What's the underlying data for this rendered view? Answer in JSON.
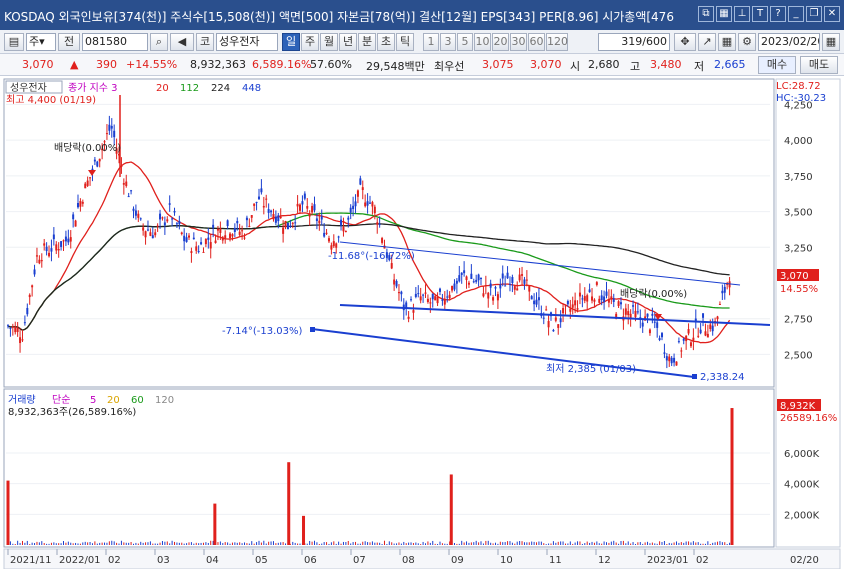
{
  "window": {
    "title": "KOSDAQ 외국인보유[374(천)] 주식수[15,508(천)] 액면[500] 자본금[78(억)] 결산[12월] EPS[343] PER[8.96] 시가총액[476"
  },
  "toolbar": {
    "type_select": "주",
    "prev_label": "전",
    "code": "081580",
    "kospi_label": "코",
    "stock_name": "성우전자",
    "periods": [
      "일",
      "주",
      "월",
      "년",
      "분",
      "초",
      "틱"
    ],
    "active_period": "일",
    "minutes": [
      "1",
      "3",
      "5",
      "10",
      "20",
      "30",
      "60",
      "120"
    ],
    "count": "319/600",
    "date": "2023/02/20"
  },
  "quote": {
    "price": "3,070",
    "change": "390",
    "change_pct": "+14.55%",
    "volume": "8,932,363",
    "volume_pct": "6,589.16%",
    "turnover": "57.60%",
    "amount": "29,548백만",
    "top_ask_label": "최우선",
    "ask": "3,075",
    "bid": "3,070",
    "open_label": "시",
    "open": "2,680",
    "high_label": "고",
    "high": "3,480",
    "low_label": "저",
    "low": "2,665",
    "buy_button": "매수",
    "sell_button": "매도"
  },
  "price_panel": {
    "legend_name": "성우전자",
    "legend_ma_label": "종가 지수 3",
    "legend_ma": [
      {
        "label": "20",
        "color": "#e0201c"
      },
      {
        "label": "112",
        "color": "#1a9a1a"
      },
      {
        "label": "224",
        "color": "#222222"
      },
      {
        "label": "448",
        "color": "#1a3fd0"
      }
    ],
    "max_label": "최고 4,400 (01/19)",
    "min_label": "최저 2,385 (01/03)",
    "dividend_label_1": "배당락(0.00%)",
    "dividend_label_2": "배당락(0.00%)",
    "trend_label_1": "-11.68°(-16.72%)",
    "trend_label_2": "-7.14°(-13.03%)",
    "trend_end_value": "2,338.24",
    "lc_label": "LC:28.72",
    "hc_label": "HC:-30.23",
    "y_ticks": [
      "4,250",
      "4,000",
      "3,750",
      "3,500",
      "3,250",
      "2,750",
      "2,500"
    ],
    "current_price_tag": "3,070",
    "current_pct_tag": "14.55%"
  },
  "volume_panel": {
    "legend_label": "거래량",
    "legend_ma_label": "단순",
    "legend_ma": [
      {
        "label": "5",
        "color": "#c000c0"
      },
      {
        "label": "20",
        "color": "#d9a400"
      },
      {
        "label": "60",
        "color": "#1a9a1a"
      },
      {
        "label": "120",
        "color": "#888888"
      }
    ],
    "volume_text": "8,932,363주(26,589.16%)",
    "y_ticks": [
      "6,000K",
      "4,000K",
      "2,000K"
    ],
    "current_tag_1": "8,932K",
    "current_tag_2": "26589.16%"
  },
  "x_axis": {
    "labels": [
      "2021/11",
      "2022/01",
      "02",
      "03",
      "04",
      "05",
      "06",
      "07",
      "08",
      "09",
      "10",
      "11",
      "12",
      "2023/01",
      "02"
    ],
    "right_label": "02/20"
  },
  "chart_data": {
    "type": "candlestick",
    "y_range": [
      2300,
      4400
    ],
    "price_path_points": [
      [
        0,
        2700
      ],
      [
        1,
        2650
      ],
      [
        2,
        3200
      ],
      [
        3,
        3250
      ],
      [
        4,
        3300
      ],
      [
        5,
        3600
      ],
      [
        6,
        3850
      ],
      [
        7,
        4100
      ],
      [
        8,
        3700
      ],
      [
        9,
        3400
      ],
      [
        10,
        3350
      ],
      [
        11,
        3500
      ],
      [
        12,
        3300
      ],
      [
        13,
        3250
      ],
      [
        14,
        3350
      ],
      [
        15,
        3400
      ],
      [
        16,
        3350
      ],
      [
        17,
        3600
      ],
      [
        18,
        3500
      ],
      [
        19,
        3400
      ],
      [
        20,
        3550
      ],
      [
        21,
        3450
      ],
      [
        22,
        3300
      ],
      [
        23,
        3400
      ],
      [
        24,
        3650
      ],
      [
        25,
        3500
      ],
      [
        26,
        3100
      ],
      [
        27,
        2800
      ],
      [
        28,
        2900
      ],
      [
        29,
        2850
      ],
      [
        30,
        2950
      ],
      [
        31,
        3050
      ],
      [
        32,
        3000
      ],
      [
        33,
        2900
      ],
      [
        34,
        3050
      ],
      [
        35,
        3000
      ],
      [
        36,
        2850
      ],
      [
        37,
        2700
      ],
      [
        38,
        2800
      ],
      [
        39,
        2900
      ],
      [
        40,
        2950
      ],
      [
        41,
        2850
      ],
      [
        42,
        2800
      ],
      [
        43,
        2750
      ],
      [
        44,
        2700
      ],
      [
        45,
        2450
      ],
      [
        46,
        2600
      ],
      [
        47,
        2700
      ],
      [
        48,
        2700
      ],
      [
        49,
        3070
      ]
    ],
    "volume_spikes": [
      {
        "x": 0,
        "value": 4200
      },
      {
        "x": 14,
        "value": 2700
      },
      {
        "x": 19,
        "value": 5400
      },
      {
        "x": 20,
        "value": 1900
      },
      {
        "x": 30,
        "value": 4600
      },
      {
        "x": 49,
        "value": 8932
      }
    ]
  }
}
